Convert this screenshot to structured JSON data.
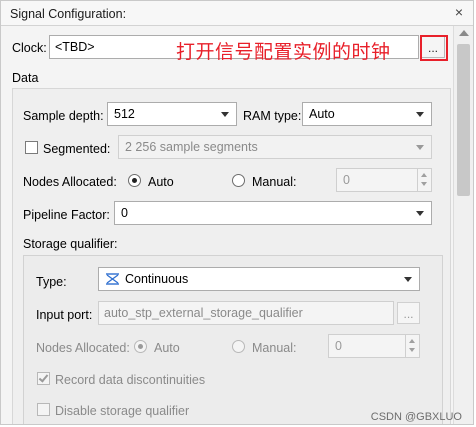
{
  "window": {
    "title": "Signal Configuration:",
    "close_glyph": "×"
  },
  "clock": {
    "label": "Clock:",
    "value": "<TBD>",
    "browse_label": "...",
    "annotation": "打开信号配置实例的时钟",
    "annotation_color": "#e8202a"
  },
  "data_section": {
    "label": "Data",
    "sample_depth_label": "Sample depth:",
    "sample_depth_value": "512",
    "ram_type_label": "RAM type:",
    "ram_type_value": "Auto",
    "segmented_label": "Segmented:",
    "segmented_checked": false,
    "segmented_value": "2  256 sample segments",
    "nodes_allocated_label": "Nodes Allocated:",
    "nodes_auto_label": "Auto",
    "nodes_manual_label": "Manual:",
    "nodes_manual_value": "0",
    "nodes_mode": "auto",
    "pipeline_factor_label": "Pipeline Factor:",
    "pipeline_factor_value": "0"
  },
  "storage_qualifier": {
    "label": "Storage qualifier:",
    "type_label": "Type:",
    "type_value": "Continuous",
    "type_icon": "continuous-icon",
    "input_port_label": "Input port:",
    "input_port_value": "auto_stp_external_storage_qualifier",
    "input_port_browse": "...",
    "nodes_allocated_label": "Nodes Allocated:",
    "nodes_auto_label": "Auto",
    "nodes_manual_label": "Manual:",
    "nodes_manual_value": "0",
    "record_discontinuities_label": "Record data discontinuities",
    "record_discontinuities_checked": true,
    "disable_qualifier_label": "Disable storage qualifier",
    "disable_qualifier_checked": false
  },
  "watermark": "CSDN @GBXLUO",
  "colors": {
    "accent_red": "#e8202a",
    "icon_blue": "#2f6fd0"
  }
}
